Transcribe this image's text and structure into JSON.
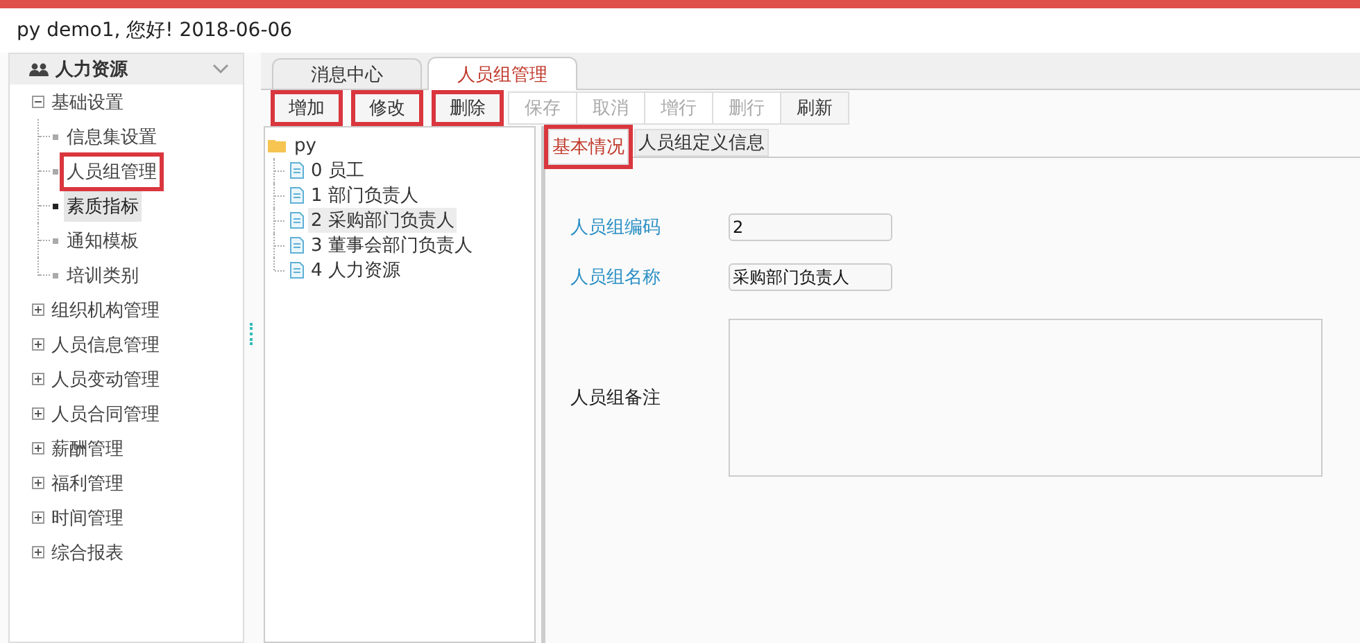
{
  "header": {
    "greeting": "py demo1, 您好! 2018-06-06"
  },
  "sidebar": {
    "title": "人力资源",
    "expanded": true,
    "items": [
      {
        "label": "基础设置",
        "expanded": true,
        "children": [
          {
            "label": "信息集设置",
            "selected": false,
            "highlighted": false
          },
          {
            "label": "人员组管理",
            "selected": false,
            "highlighted": true
          },
          {
            "label": "素质指标",
            "selected": true,
            "highlighted": false
          },
          {
            "label": "通知模板",
            "selected": false,
            "highlighted": false
          },
          {
            "label": "培训类别",
            "selected": false,
            "highlighted": false
          }
        ]
      },
      {
        "label": "组织机构管理",
        "expanded": false
      },
      {
        "label": "人员信息管理",
        "expanded": false
      },
      {
        "label": "人员变动管理",
        "expanded": false
      },
      {
        "label": "人员合同管理",
        "expanded": false
      },
      {
        "label": "薪酬管理",
        "expanded": false
      },
      {
        "label": "福利管理",
        "expanded": false
      },
      {
        "label": "时间管理",
        "expanded": false
      },
      {
        "label": "综合报表",
        "expanded": false
      }
    ]
  },
  "tabs": [
    {
      "label": "消息中心",
      "selected": false
    },
    {
      "label": "人员组管理",
      "selected": true
    }
  ],
  "toolbar": [
    {
      "label": "增加",
      "disabled": false,
      "highlighted": true
    },
    {
      "label": "修改",
      "disabled": false,
      "highlighted": true
    },
    {
      "label": "删除",
      "disabled": false,
      "highlighted": true
    },
    {
      "label": "保存",
      "disabled": true,
      "highlighted": false
    },
    {
      "label": "取消",
      "disabled": true,
      "highlighted": false
    },
    {
      "label": "增行",
      "disabled": true,
      "highlighted": false
    },
    {
      "label": "删行",
      "disabled": true,
      "highlighted": false
    },
    {
      "label": "刷新",
      "disabled": false,
      "highlighted": false
    }
  ],
  "group_tree": {
    "root": "py",
    "children": [
      {
        "label": "0 员工",
        "selected": false
      },
      {
        "label": "1 部门负责人",
        "selected": false
      },
      {
        "label": "2 采购部门负责人",
        "selected": true
      },
      {
        "label": "3 董事会部门负责人",
        "selected": false
      },
      {
        "label": "4 人力资源",
        "selected": false
      }
    ]
  },
  "detail_tabs": [
    {
      "label": "基本情况",
      "selected": true,
      "highlighted": true
    },
    {
      "label": "人员组定义信息",
      "selected": false,
      "highlighted": false
    }
  ],
  "form": [
    {
      "label": "人员组编码",
      "kind": "input",
      "required": true,
      "value": "2"
    },
    {
      "label": "人员组名称",
      "kind": "input",
      "required": true,
      "value": "采购部门负责人"
    },
    {
      "label": "人员组备注",
      "kind": "textarea",
      "required": false
    }
  ]
}
